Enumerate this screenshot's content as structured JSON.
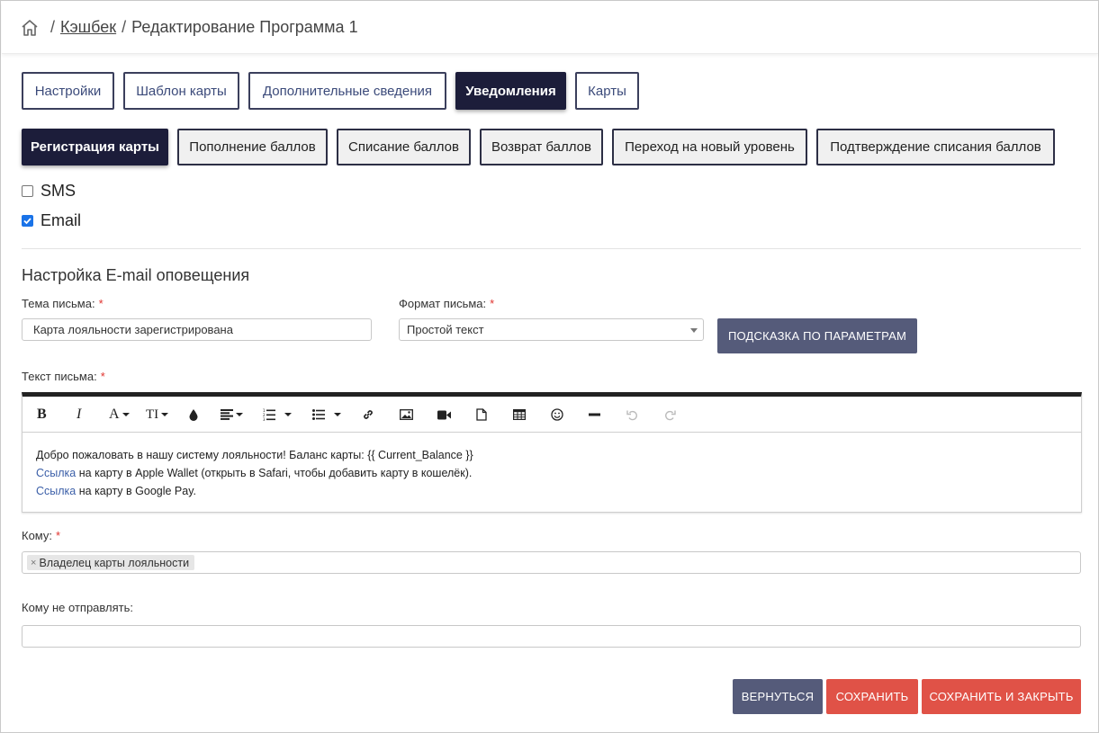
{
  "breadcrumb": {
    "home_icon": "home-icon",
    "separator": "/",
    "link": "Кэшбек",
    "current": "Редактирование Программа 1"
  },
  "tabs_main": [
    {
      "label": "Настройки",
      "active": false
    },
    {
      "label": "Шаблон карты",
      "active": false
    },
    {
      "label": "Дополнительные сведения",
      "active": false
    },
    {
      "label": "Уведомления",
      "active": true
    },
    {
      "label": "Карты",
      "active": false
    }
  ],
  "tabs_sub": [
    {
      "label": "Регистрация карты",
      "active": true
    },
    {
      "label": "Пополнение баллов",
      "active": false
    },
    {
      "label": "Списание баллов",
      "active": false
    },
    {
      "label": "Возврат баллов",
      "active": false
    },
    {
      "label": "Переход на новый уровень",
      "active": false
    },
    {
      "label": "Подтверждение списания баллов",
      "active": false
    }
  ],
  "channels": {
    "sms": {
      "label": "SMS",
      "checked": false
    },
    "email": {
      "label": "Email",
      "checked": true
    }
  },
  "section_title": "Настройка E-mail оповещения",
  "subject": {
    "label": "Тема письма:",
    "required_mark": "*",
    "value": "Карта лояльности зарегистрирована"
  },
  "format": {
    "label": "Формат письма:",
    "required_mark": "*",
    "value": "Простой текст"
  },
  "hint_button": "Подсказка по параметрам",
  "body": {
    "label": "Текст письма:",
    "required_mark": "*",
    "line1": "Добро пожаловать в нашу систему лояльности! Баланс карты: {{ Current_Balance }}",
    "line2_link": "Ссылка",
    "line2_rest": " на карту в Apple Wallet (открыть в Safari, чтобы добавить карту в кошелёк).",
    "line3_link": "Ссылка",
    "line3_rest": " на карту в Google Pay."
  },
  "toolbar": {
    "bold": "B",
    "italic": "I",
    "font_color": "A",
    "font_size": "TI"
  },
  "to": {
    "label": "Кому:",
    "required_mark": "*",
    "tag": "Владелец карты лояльности",
    "tag_remove": "×"
  },
  "exclude": {
    "label": "Кому не отправлять:",
    "value": ""
  },
  "actions": {
    "back": "Вернуться",
    "save": "Сохранить",
    "save_close": "Сохранить и закрыть"
  },
  "colors": {
    "active_tab": "#1c1d3a",
    "navy_button": "#555b7a",
    "red_button": "#e05247",
    "link": "#3b5fa8",
    "required": "#e0332e"
  }
}
